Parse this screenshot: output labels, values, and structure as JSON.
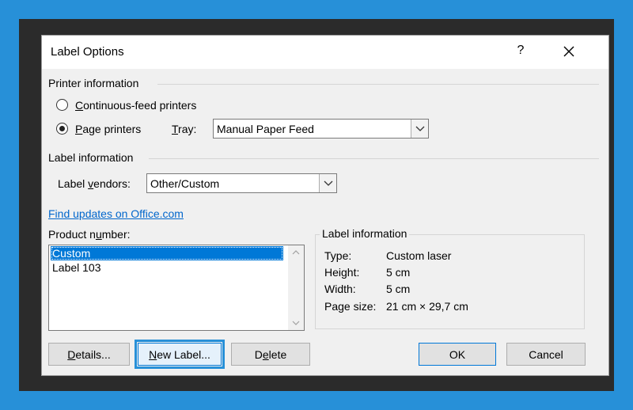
{
  "dialog": {
    "title": "Label Options",
    "help_label": "?",
    "close_label": "×"
  },
  "printer_info": {
    "heading": "Printer information",
    "continuous_feed": {
      "before": "",
      "underlined": "C",
      "after": "ontinuous-feed printers",
      "checked": false
    },
    "page_printers": {
      "before": "",
      "underlined": "P",
      "after": "age printers",
      "checked": true
    },
    "tray_label": {
      "before": "",
      "underlined": "T",
      "after": "ray:"
    },
    "tray_value": "Manual Paper Feed"
  },
  "label_info": {
    "heading": "Label information",
    "vendors_label": {
      "before": "Label ",
      "underlined": "v",
      "after": "endors:"
    },
    "vendors_value": "Other/Custom",
    "find_updates_link": "Find updates on Office.com",
    "product_number_label": {
      "before": "Product n",
      "underlined": "u",
      "after": "mber:"
    },
    "product_items": [
      {
        "label": "Custom",
        "selected": true
      },
      {
        "label": "Label 103",
        "selected": false
      }
    ]
  },
  "details_group": {
    "heading": "Label information",
    "rows": [
      {
        "key": "Type:",
        "value": "Custom laser"
      },
      {
        "key": "Height:",
        "value": "5 cm"
      },
      {
        "key": "Width:",
        "value": "5 cm"
      },
      {
        "key": "Page size:",
        "value": "21 cm × 29,7 cm"
      }
    ]
  },
  "buttons": {
    "details": {
      "before": "",
      "underlined": "D",
      "after": "etails..."
    },
    "new_label": {
      "before": "",
      "underlined": "N",
      "after": "ew Label..."
    },
    "delete": {
      "before": "D",
      "underlined": "e",
      "after": "lete"
    },
    "ok": "OK",
    "cancel": "Cancel"
  },
  "colors": {
    "background": "#2790d8",
    "frame": "#2b2b2b",
    "selection": "#0078d7",
    "link": "#0066cc"
  }
}
